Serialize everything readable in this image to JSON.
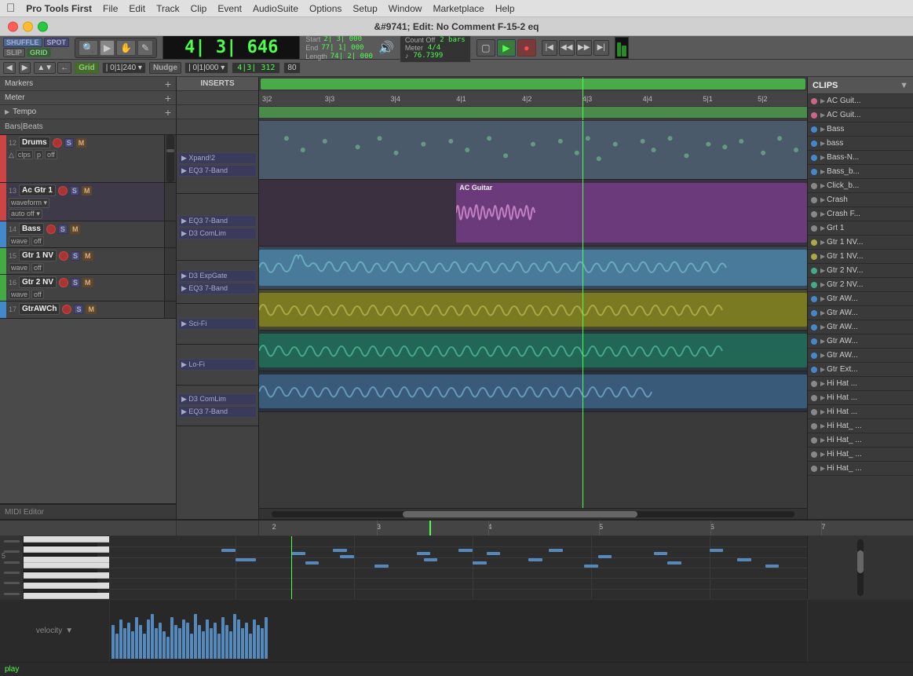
{
  "menubar": {
    "apple": "&#63743;",
    "appname": "Pro Tools First",
    "items": [
      "File",
      "Edit",
      "Track",
      "Clip",
      "Event",
      "AudioSuite",
      "Options",
      "Setup",
      "Window",
      "Marketplace",
      "Help"
    ]
  },
  "titlebar": {
    "title": "&#9741; Edit: No Comment F-15-2 eq"
  },
  "toolbar": {
    "modes": [
      "SHUFFLE",
      "SPOT",
      "SLIP",
      "GRID"
    ],
    "grid_label": "Grid",
    "nudge_label": "Nudge",
    "grid_value": "| 0|1|240 ▾",
    "nudge_value": "| 0|1|000 ▾",
    "counter_display": "4| 3| 646",
    "start_label": "Start",
    "end_label": "End",
    "length_label": "Length",
    "start_val": "2| 3| 000",
    "end_val": "77| 1| 000",
    "length_val": "74| 2| 000",
    "cursor_val": "4|3| 312",
    "zoom_val": "80",
    "count_off": "Count Off",
    "meter_label": "Meter",
    "tempo_label": "Tempo",
    "meter_val": "4/4",
    "tempo_val": "76.7399",
    "bars_label": "2 bars"
  },
  "markers": {
    "label": "Markers"
  },
  "meter": {
    "label": "Meter"
  },
  "tempo": {
    "label": "Tempo"
  },
  "ruler": {
    "label": "Bars|Beats",
    "ticks": [
      "3|2",
      "3|3",
      "3|4",
      "4|1",
      "4|2",
      "4|3",
      "4|4",
      "5|1",
      "5|2"
    ]
  },
  "inserts": {
    "label": "INSERTS"
  },
  "tracks": [
    {
      "num": "12",
      "name": "Drums",
      "color": "#cc4444",
      "inserts": [
        "Xpand!2",
        "EQ3 7-Band"
      ],
      "type": "drums"
    },
    {
      "num": "13",
      "name": "Ac Gtr 1",
      "color": "#cc4444",
      "inserts": [
        "EQ3 7-Band",
        "D3 ComLim"
      ],
      "type": "ac-guitar",
      "clip_label": "AC Guitar"
    },
    {
      "num": "14",
      "name": "Bass",
      "color": "#4488cc",
      "inserts": [
        "D3 ExpGate",
        "EQ3 7-Band"
      ],
      "type": "bass"
    },
    {
      "num": "15",
      "name": "Gtr 1 NV",
      "color": "#44aa44",
      "inserts": [
        "Sci-Fi"
      ],
      "type": "gtr1nv"
    },
    {
      "num": "16",
      "name": "Gtr 2 NV",
      "color": "#44aa44",
      "inserts": [
        "Lo-Fi"
      ],
      "type": "gtr2nv"
    },
    {
      "num": "17",
      "name": "GtrAWCh",
      "color": "#4488cc",
      "inserts": [
        "D3 ComLim",
        "EQ3 7-Band"
      ],
      "type": "gtraWch"
    }
  ],
  "clips_panel": {
    "title": "CLIPS",
    "items": [
      {
        "name": "AC Guit...",
        "color": "#cc6688"
      },
      {
        "name": "AC Guit...",
        "color": "#cc6688"
      },
      {
        "name": "Bass",
        "color": "#4488cc"
      },
      {
        "name": "bass",
        "color": "#4488cc"
      },
      {
        "name": "Bass-N...",
        "color": "#4488cc"
      },
      {
        "name": "Bass_b...",
        "color": "#4488cc"
      },
      {
        "name": "Click_b...",
        "color": "#888888"
      },
      {
        "name": "Crash",
        "color": "#888888"
      },
      {
        "name": "Crash F...",
        "color": "#888888"
      },
      {
        "name": "Grt 1",
        "color": "#888888"
      },
      {
        "name": "Gtr 1 NV...",
        "color": "#aaaa44"
      },
      {
        "name": "Gtr 1 NV...",
        "color": "#aaaa44"
      },
      {
        "name": "Gtr 2 NV...",
        "color": "#44aa88"
      },
      {
        "name": "Gtr 2 NV...",
        "color": "#44aa88"
      },
      {
        "name": "Gtr AW...",
        "color": "#4488cc"
      },
      {
        "name": "Gtr AW...",
        "color": "#4488cc"
      },
      {
        "name": "Gtr AW...",
        "color": "#4488cc"
      },
      {
        "name": "Gtr AW...",
        "color": "#4488cc"
      },
      {
        "name": "Gtr AW...",
        "color": "#4488cc"
      },
      {
        "name": "Gtr Ext...",
        "color": "#4488cc"
      },
      {
        "name": "Hi Hat ...",
        "color": "#888888"
      },
      {
        "name": "Hi Hat ...",
        "color": "#888888"
      },
      {
        "name": "Hi Hat ...",
        "color": "#888888"
      },
      {
        "name": "Hi Hat_ ...",
        "color": "#888888"
      },
      {
        "name": "Hi Hat_ ...",
        "color": "#888888"
      },
      {
        "name": "Hi Hat_ ...",
        "color": "#888888"
      },
      {
        "name": "Hi Hat_ ...",
        "color": "#888888"
      }
    ]
  },
  "midi_editor": {
    "label": "MIDI Editor",
    "velocity_label": "velocity",
    "play_label": "play"
  },
  "bottom_ruler": {
    "ticks": [
      "2",
      "3",
      "4",
      "5",
      "6",
      "7"
    ]
  }
}
